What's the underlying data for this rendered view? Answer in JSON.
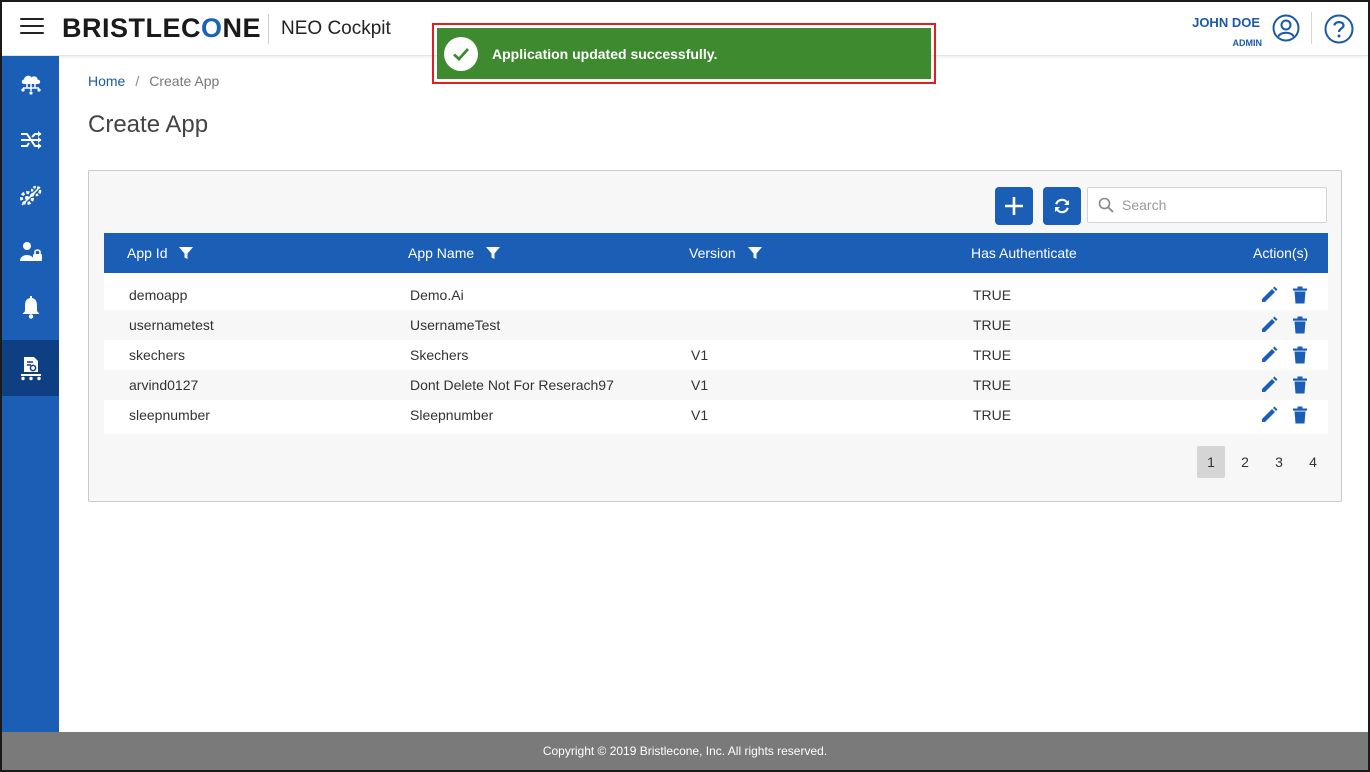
{
  "header": {
    "logo_text_1": "BRISTLEC",
    "logo_text_2": "O",
    "logo_text_3": "NE",
    "app_title": "NEO Cockpit",
    "user_name": "JOHN DOE",
    "user_role": "ADMIN"
  },
  "toast": {
    "message": "Application updated successfully.",
    "color": "#3d8a2f"
  },
  "sidebar": {
    "items": [
      {
        "icon": "cloud-network-icon"
      },
      {
        "icon": "flow-arrows-icon"
      },
      {
        "icon": "gears-icon"
      },
      {
        "icon": "user-lock-icon"
      },
      {
        "icon": "bell-icon"
      },
      {
        "icon": "app-conveyor-icon",
        "active": true
      }
    ],
    "color": "#1b5eb5"
  },
  "breadcrumb": {
    "home": "Home",
    "separator": "/",
    "current": "Create App"
  },
  "page": {
    "title": "Create App"
  },
  "toolbar": {
    "search_placeholder": "Search"
  },
  "table": {
    "headers": {
      "app_id": "App Id",
      "app_name": "App Name",
      "version": "Version",
      "has_authenticate": "Has Authenticate",
      "actions": "Action(s)"
    },
    "rows": [
      {
        "app_id": "demoapp",
        "app_name": "Demo.Ai",
        "version": "",
        "has_authenticate": "TRUE"
      },
      {
        "app_id": "usernametest",
        "app_name": "UsernameTest",
        "version": "",
        "has_authenticate": "TRUE"
      },
      {
        "app_id": "skechers",
        "app_name": "Skechers",
        "version": "V1",
        "has_authenticate": "TRUE"
      },
      {
        "app_id": "arvind0127",
        "app_name": "Dont Delete Not For Reserach97",
        "version": "V1",
        "has_authenticate": "TRUE"
      },
      {
        "app_id": "sleepnumber",
        "app_name": "Sleepnumber",
        "version": "V1",
        "has_authenticate": "TRUE"
      }
    ]
  },
  "pagination": {
    "pages": [
      "1",
      "2",
      "3",
      "4"
    ],
    "current": "1"
  },
  "footer": {
    "text": "Copyright © 2019 Bristlecone, Inc. All rights reserved."
  }
}
